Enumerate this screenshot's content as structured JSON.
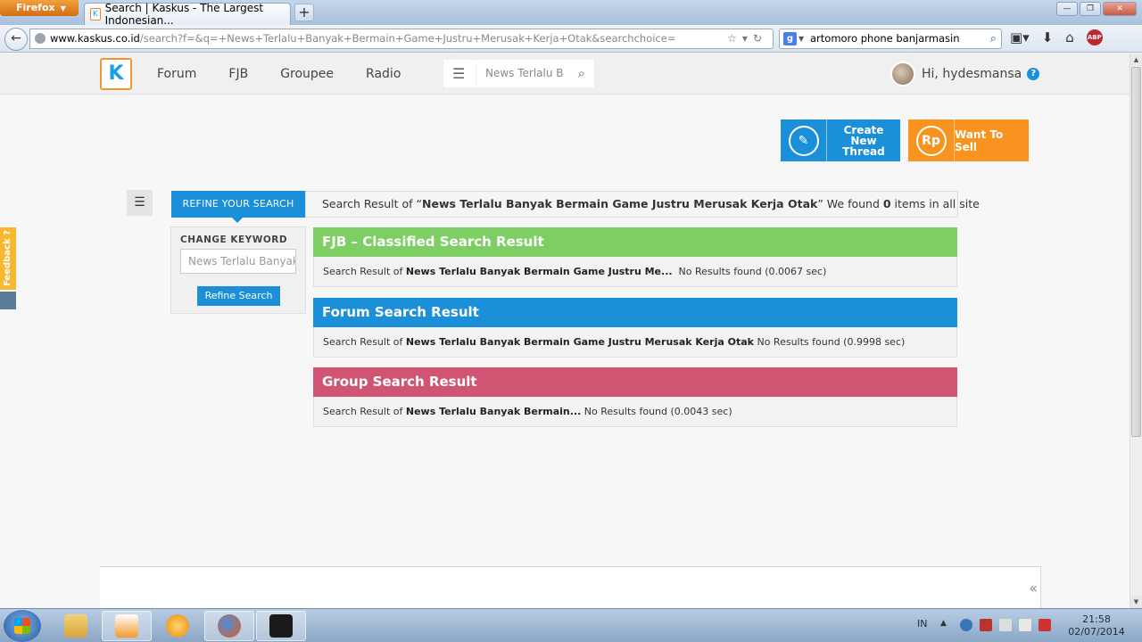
{
  "browser": {
    "menu_label": "Firefox",
    "tab_title": "Search | Kaskus - The Largest Indonesian...",
    "new_tab": "+",
    "url_host": "www.kaskus.co.id",
    "url_path": "/search?f=&q=+News+Terlalu+Banyak+Bermain+Game+Justru+Merusak+Kerja+Otak&searchchoice=",
    "search_engine_letter": "g",
    "search_text": "artomoro phone banjarmasin",
    "abp_label": "ABP"
  },
  "header": {
    "logo_glyph": "K",
    "nav": [
      "Forum",
      "FJB",
      "Groupee",
      "Radio"
    ],
    "search_placeholder": "News Terlalu Ba",
    "greeting": "Hi, hydesmansa",
    "help": "?"
  },
  "actions": {
    "create_thread": "Create New Thread",
    "want_to_sell": "Want To Sell",
    "sell_icon": "Rp"
  },
  "search": {
    "refine_tab": "REFINE YOUR SEARCH",
    "summary_prefix": "Search Result of “",
    "query": "News Terlalu Banyak Bermain Game Justru Merusak Kerja Otak",
    "summary_mid": "” We found ",
    "count": "0",
    "summary_suffix": " items in all site",
    "change_keyword_label": "CHANGE KEYWORD",
    "keyword_value": "News Terlalu Banyak",
    "refine_button": "Refine Search"
  },
  "results": [
    {
      "title": "FJB – Classified Search Result",
      "color": "#7dcf63",
      "prefix": "Search Result of ",
      "query": "News Terlalu Banyak Bermain Game Justru Me...",
      "status": "  No Results found (0.0067 sec)"
    },
    {
      "title": "Forum Search Result",
      "color": "#1b8fd8",
      "prefix": "Search Result of ",
      "query": "News Terlalu Banyak Bermain Game Justru Merusak Kerja Otak",
      "status": " No Results found (0.9998 sec)"
    },
    {
      "title": "Group Search Result",
      "color": "#d05573",
      "prefix": "Search Result of ",
      "query": "News Terlalu Banyak Bermain...",
      "status": " No Results found (0.0043 sec)"
    }
  ],
  "feedback_label": "Feedback ?",
  "collapse_glyph": "«",
  "taskbar": {
    "language": "IN",
    "time": "21:58",
    "date": "02/07/2014"
  }
}
